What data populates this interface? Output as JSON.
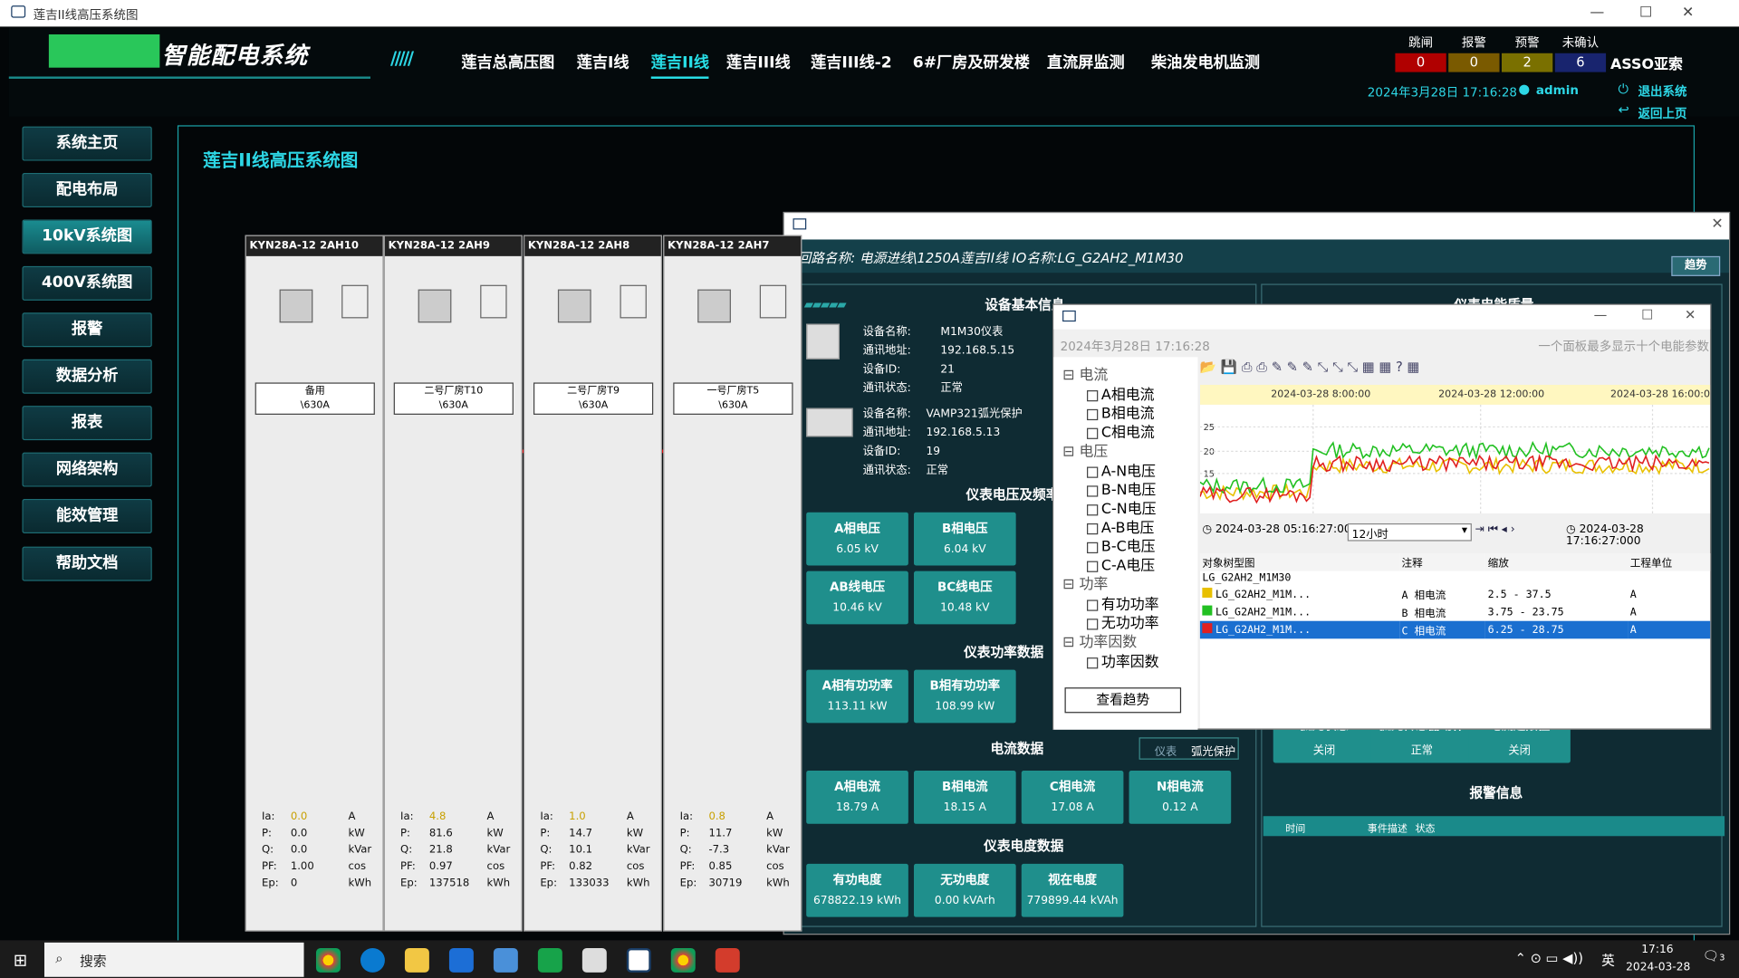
{
  "window": {
    "title": "莲吉II线高压系统图"
  },
  "header": {
    "system_name": "智能配电系统",
    "brand": "ASSO亚索",
    "datetime": "2024年3月28日 17:16:28",
    "user": "admin",
    "exit": "退出系统",
    "back": "返回上页",
    "nav": [
      "莲吉总高压图",
      "莲吉I线",
      "莲吉II线",
      "莲吉III线",
      "莲吉III线-2",
      "6#厂房及研发楼",
      "直流屏监测",
      "柴油发电机监测"
    ],
    "status": [
      {
        "label": "跳闸",
        "value": "0",
        "color": "#c00000"
      },
      {
        "label": "报警",
        "value": "0",
        "color": "#8a6a00"
      },
      {
        "label": "预警",
        "value": "2",
        "color": "#8a7a00"
      },
      {
        "label": "未确认",
        "value": "6",
        "color": "#1c2a7a"
      }
    ]
  },
  "sidebar": [
    "系统主页",
    "配电布局",
    "10kV系统图",
    "400V系统图",
    "报警",
    "数据分析",
    "报表",
    "网络架构",
    "能效管理",
    "帮助文档"
  ],
  "page_title": "莲吉II线高压系统图",
  "cabinets": [
    {
      "header": "KYN28A-12  2AH10",
      "label1": "备用",
      "label2": "\\630A",
      "Ia": "0.0",
      "P": "0.0",
      "Q": "0.0",
      "PF": "1.00",
      "Ep": "0"
    },
    {
      "header": "KYN28A-12  2AH9",
      "label1": "二号厂房T10",
      "label2": "\\630A",
      "Ia": "4.8",
      "P": "81.6",
      "Q": "21.8",
      "PF": "0.97",
      "Ep": "137518"
    },
    {
      "header": "KYN28A-12  2AH8",
      "label1": "二号厂房T9",
      "label2": "\\630A",
      "Ia": "1.0",
      "P": "14.7",
      "Q": "10.1",
      "PF": "0.82",
      "Ep": "133033"
    },
    {
      "header": "KYN28A-12  2AH7",
      "label1": "一号厂房T5",
      "label2": "\\630A",
      "Ia": "0.8",
      "P": "11.7",
      "Q": "-7.3",
      "PF": "0.85",
      "Ep": "30719"
    }
  ],
  "units": {
    "Ia": "A",
    "P": "kW",
    "Q": "kVar",
    "PF": "cos",
    "Ep": "kWh"
  },
  "meas_labels": {
    "Ia": "Ia:",
    "P": "P:",
    "Q": "Q:",
    "PF": "PF:",
    "Ep": "Ep:"
  },
  "dialog": {
    "subtitle": "回路名称: 电源进线\\1250A莲吉II线 IO名称:LG_G2AH2_M1M30",
    "trend": "趋势",
    "sec_basic": "设备基本信息",
    "sec_meter_quality": "仪表电能质量",
    "sec_voltage": "仪表电压及频率",
    "sec_power": "仪表功率数据",
    "sec_current": "电流数据",
    "sec_energy": "仪表电度数据",
    "sec_alarm": "报警信息",
    "dev1": {
      "name_lbl": "设备名称:",
      "name": "M1M30仪表",
      "addr_lbl": "通讯地址:",
      "addr": "192.168.5.15",
      "id_lbl": "设备ID:",
      "id": "21",
      "st_lbl": "通讯状态:",
      "st": "正常"
    },
    "dev2": {
      "name_lbl": "设备名称:",
      "name": "VAMP321弧光保护",
      "addr_lbl": "通讯地址:",
      "addr": "192.168.5.13",
      "id_lbl": "设备ID:",
      "id": "19",
      "st_lbl": "通讯状态:",
      "st": "正常"
    },
    "voltage": [
      {
        "n": "A相电压",
        "v": "6.05 kV"
      },
      {
        "n": "B相电压",
        "v": "6.04 kV"
      },
      {
        "n": "AB线电压",
        "v": "10.46 kV"
      },
      {
        "n": "BC线电压",
        "v": "10.48 kV"
      }
    ],
    "power": [
      {
        "n": "A相有功功率",
        "v": "113.11 kW"
      },
      {
        "n": "B相有功功率",
        "v": "108.99 kW"
      }
    ],
    "current": [
      {
        "n": "A相电流",
        "v": "18.79 A"
      },
      {
        "n": "B相电流",
        "v": "18.15 A"
      },
      {
        "n": "C相电流",
        "v": "17.08 A"
      },
      {
        "n": "N相电流",
        "v": "0.12 A"
      }
    ],
    "energy": [
      {
        "n": "有功电度",
        "v": "678822.19 kWh"
      },
      {
        "n": "无功电度",
        "v": "0.00 kVArh"
      },
      {
        "n": "视在电度",
        "v": "779899.44 kVAh"
      }
    ],
    "tabs": [
      "仪表",
      "弧光保护"
    ],
    "arc": [
      {
        "n": "弧光状态",
        "v": "关闭"
      },
      {
        "n": "弧光传感器动作",
        "v": "正常"
      },
      {
        "n": "电流达限值",
        "v": "关闭"
      }
    ],
    "alarm_cols": [
      "时间",
      "事件描述",
      "状态"
    ]
  },
  "popup": {
    "time": "2024年3月28日 17:16:28",
    "hint": "一个面板最多显示十个电能参数",
    "groups": [
      {
        "g": "电流",
        "items": [
          "A相电流",
          "B相电流",
          "C相电流"
        ]
      },
      {
        "g": "电压",
        "items": [
          "A-N电压",
          "B-N电压",
          "C-N电压",
          "A-B电压",
          "B-C电压",
          "C-A电压"
        ]
      },
      {
        "g": "功率",
        "items": [
          "有功功率",
          "无功功率"
        ]
      },
      {
        "g": "功率因数",
        "items": [
          "功率因数"
        ]
      }
    ],
    "view_btn": "查看趋势",
    "time_ticks": [
      "2024-03-28 8:00:00",
      "2024-03-28 12:00:00",
      "2024-03-28 16:00:00"
    ],
    "y_ticks": [
      "25",
      "20",
      "15"
    ],
    "start": "2024-03-28 05:16:27:000",
    "span": "12小时",
    "end": "2024-03-28 17:16:27:000",
    "cols": [
      "对象树型图",
      "注释",
      "缩放",
      "工程单位"
    ],
    "root": "LG_G2AH2_M1M30",
    "rows": [
      {
        "obj": "LG_G2AH2_M1M...",
        "note": "A 相电流",
        "scale": "2.5 - 37.5",
        "unit": "A",
        "color": "#e8c000"
      },
      {
        "obj": "LG_G2AH2_M1M...",
        "note": "B 相电流",
        "scale": "3.75 - 23.75",
        "unit": "A",
        "color": "#22c022"
      },
      {
        "obj": "LG_G2AH2_M1M...",
        "note": "C 相电流",
        "scale": "6.25 - 28.75",
        "unit": "A",
        "color": "#e02020"
      }
    ]
  },
  "taskbar": {
    "search": "搜索",
    "time": "17:16",
    "date": "2024-03-28",
    "ime": "英",
    "notif": "3"
  }
}
